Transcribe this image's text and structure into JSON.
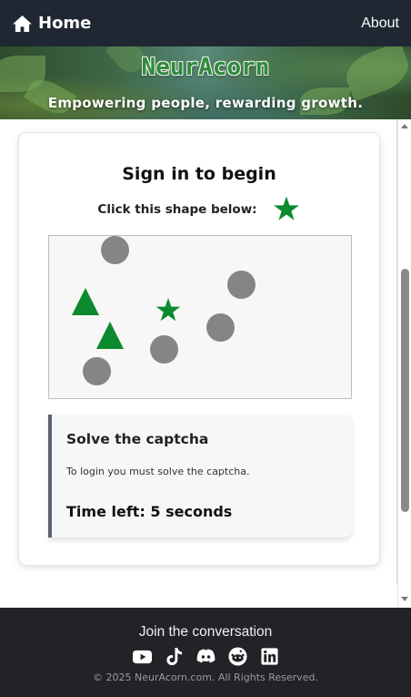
{
  "nav": {
    "home_label": "Home",
    "about_label": "About",
    "home_icon": "home-icon"
  },
  "banner": {
    "brand": "NeurAcorn",
    "tagline": "Empowering people, rewarding growth."
  },
  "card": {
    "title": "Sign in to begin",
    "prompt": "Click this shape below:",
    "target_shape": "star",
    "target_color": "#0c8a2e"
  },
  "captcha": {
    "shapes": [
      {
        "type": "circle",
        "color": "#858585"
      },
      {
        "type": "circle",
        "color": "#858585"
      },
      {
        "type": "triangle",
        "color": "#0c8a2e"
      },
      {
        "type": "star",
        "color": "#0c8a2e"
      },
      {
        "type": "circle",
        "color": "#858585"
      },
      {
        "type": "triangle",
        "color": "#0c8a2e"
      },
      {
        "type": "circle",
        "color": "#858585"
      },
      {
        "type": "circle",
        "color": "#858585"
      }
    ]
  },
  "panel": {
    "title": "Solve the captcha",
    "text": "To login you must solve the captcha.",
    "timer": "Time left: 5 seconds"
  },
  "footer": {
    "join": "Join the conversation",
    "socials": [
      "youtube-icon",
      "tiktok-icon",
      "discord-icon",
      "reddit-icon",
      "linkedin-icon"
    ],
    "copyright": "© 2025 NeurAcorn.com. All Rights Reserved."
  }
}
